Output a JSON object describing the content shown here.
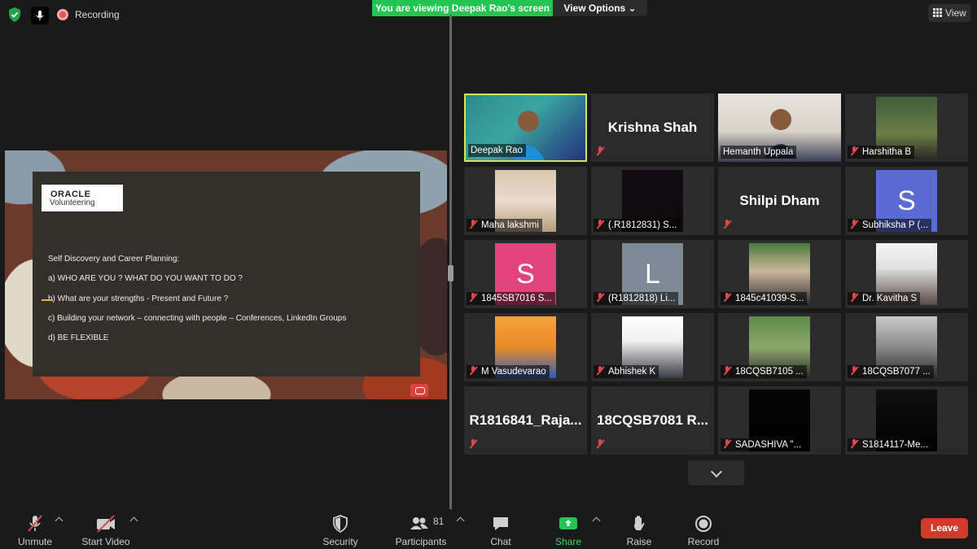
{
  "top_bar": {
    "recording_label": "Recording",
    "viewing_banner": "You are viewing Deepak Rao's screen",
    "view_options_label": "View Options ⌄",
    "view_button_label": "View"
  },
  "slide": {
    "logo_line1": "ORACLE",
    "logo_line2": "Volunteering",
    "title": "Self Discovery and Career Planning:",
    "items": [
      "a)  WHO ARE YOU ? WHAT DO YOU WANT TO DO ?",
      "b)  What are your strengths  - Present and Future ?",
      "c)  Building your network – connecting with people – Conferences, LinkedIn Groups",
      "d)  BE FLEXIBLE"
    ]
  },
  "participants": [
    {
      "label": "Deepak Rao",
      "muted": false,
      "kind": "video",
      "active": true
    },
    {
      "label": "Krishna Shah",
      "muted": true,
      "kind": "name"
    },
    {
      "label": "Hemanth Uppala",
      "muted": false,
      "kind": "video"
    },
    {
      "label": "Harshitha B",
      "muted": true,
      "kind": "photo"
    },
    {
      "label": "Maha lakshmi",
      "muted": true,
      "kind": "photo"
    },
    {
      "label": "(.R1812831) S...",
      "muted": true,
      "kind": "photo"
    },
    {
      "label": "Shilpi Dham",
      "muted": true,
      "kind": "name"
    },
    {
      "label": "Subhiksha P (...",
      "muted": true,
      "kind": "letter",
      "letter": "S",
      "color": "#5b6bd6"
    },
    {
      "label": "1845SB7016 S...",
      "muted": true,
      "kind": "letter",
      "letter": "S",
      "color": "#e0447a"
    },
    {
      "label": "(R1812818) Li...",
      "muted": true,
      "kind": "letter",
      "letter": "L",
      "color": "#7d8a96"
    },
    {
      "label": "1845c41039-S...",
      "muted": true,
      "kind": "photo"
    },
    {
      "label": "Dr. Kavitha S",
      "muted": true,
      "kind": "photo"
    },
    {
      "label": "M Vasudevarao",
      "muted": true,
      "kind": "photo"
    },
    {
      "label": "Abhishek K",
      "muted": true,
      "kind": "photo"
    },
    {
      "label": "18CQSB7105 ...",
      "muted": true,
      "kind": "photo"
    },
    {
      "label": "18CQSB7077 ...",
      "muted": true,
      "kind": "photo"
    },
    {
      "label": "R1816841_Raja...",
      "muted": true,
      "kind": "name"
    },
    {
      "label": "18CQSB7081  R...",
      "muted": true,
      "kind": "name"
    },
    {
      "label": "SADASHIVA  \"...",
      "muted": true,
      "kind": "photo"
    },
    {
      "label": "S1814117-Me...",
      "muted": true,
      "kind": "photo"
    }
  ],
  "toolbar": {
    "unmute": "Unmute",
    "start_video": "Start Video",
    "security": "Security",
    "participants": "Participants",
    "participants_count": "81",
    "chat": "Chat",
    "share_screen": "Share Screen",
    "raise_hand": "Raise Hand",
    "record": "Record",
    "leave": "Leave"
  },
  "colors": {
    "share_green": "#23c552",
    "leave_red": "#d33a2c",
    "active_speaker": "#d6e35a",
    "muted_red": "#e04848"
  }
}
